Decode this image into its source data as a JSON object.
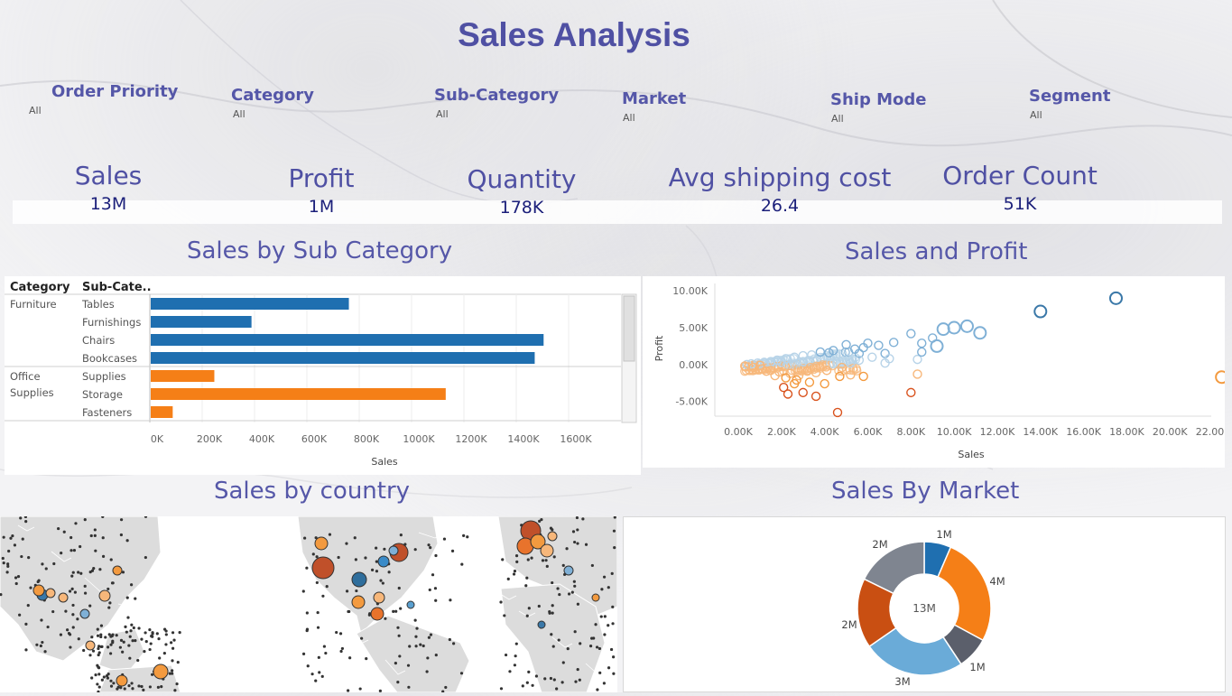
{
  "title": "Sales Analysis",
  "filters": [
    {
      "label": "Order Priority",
      "value": "All"
    },
    {
      "label": "Category",
      "value": "All"
    },
    {
      "label": "Sub-Category",
      "value": "All"
    },
    {
      "label": "Market",
      "value": "All"
    },
    {
      "label": "Ship Mode",
      "value": "All"
    },
    {
      "label": "Segment",
      "value": "All"
    }
  ],
  "kpis": [
    {
      "label": "Sales",
      "value": "13M"
    },
    {
      "label": "Profit",
      "value": "1M"
    },
    {
      "label": "Quantity",
      "value": "178K"
    },
    {
      "label": "Avg shipping cost",
      "value": "26.4"
    },
    {
      "label": "Order Count",
      "value": "51K"
    }
  ],
  "sections": {
    "subcategory": "Sales by Sub Category",
    "scatter": "Sales and Profit",
    "country": "Sales by country",
    "market": "Sales By Market"
  },
  "colors": {
    "furniture": "#1f6fb0",
    "office": "#f57f17",
    "accent": "#4f50a3"
  },
  "chart_data": [
    {
      "type": "bar",
      "orientation": "horizontal",
      "headers": [
        "Category",
        "Sub-Cate.."
      ],
      "xlabel": "Sales",
      "xlim": [
        0,
        1800000
      ],
      "ticks": [
        "0K",
        "200K",
        "400K",
        "600K",
        "800K",
        "1000K",
        "1200K",
        "1400K",
        "1600K"
      ],
      "groups": [
        {
          "category": "Furniture",
          "color": "#1f6fb0",
          "items": [
            {
              "name": "Tables",
              "value": 757000
            },
            {
              "name": "Furnishings",
              "value": 385000
            },
            {
              "name": "Chairs",
              "value": 1501000
            },
            {
              "name": "Bookcases",
              "value": 1467000
            }
          ]
        },
        {
          "category": "Office Supplies",
          "color": "#f57f17",
          "items": [
            {
              "name": "Supplies",
              "value": 243000
            },
            {
              "name": "Storage",
              "value": 1127000
            },
            {
              "name": "Fasteners",
              "value": 84000
            }
          ]
        }
      ]
    },
    {
      "type": "scatter",
      "xlabel": "Sales",
      "ylabel": "Profit",
      "xlim": [
        0,
        23000
      ],
      "ylim": [
        -7000,
        11000
      ],
      "xticks": [
        "0.00K",
        "2.00K",
        "4.00K",
        "6.00K",
        "8.00K",
        "10.00K",
        "12.00K",
        "14.00K",
        "16.00K",
        "18.00K",
        "20.00K",
        "22.00K"
      ],
      "yticks": [
        "10.00K",
        "5.00K",
        "0.00K",
        "-5.00K"
      ],
      "points": [
        [
          17500,
          9000
        ],
        [
          14000,
          7200
        ],
        [
          22400,
          -1700
        ],
        [
          11200,
          4300
        ],
        [
          10600,
          5200
        ],
        [
          10000,
          5000
        ],
        [
          9500,
          4800
        ],
        [
          9000,
          3600
        ],
        [
          8500,
          2900
        ],
        [
          9200,
          2500
        ],
        [
          8000,
          4200
        ],
        [
          7200,
          3000
        ],
        [
          6500,
          2600
        ],
        [
          6000,
          2900
        ],
        [
          5800,
          2300
        ],
        [
          5400,
          2100
        ],
        [
          5000,
          2700
        ],
        [
          8300,
          -1300
        ],
        [
          8000,
          -3800
        ],
        [
          8300,
          700
        ],
        [
          8500,
          1700
        ],
        [
          5800,
          -1600
        ],
        [
          5200,
          -1400
        ],
        [
          4700,
          -1600
        ],
        [
          4000,
          -2600
        ],
        [
          3600,
          -4300
        ],
        [
          3000,
          -3800
        ],
        [
          2600,
          -2600
        ],
        [
          2300,
          -4000
        ],
        [
          2100,
          -3100
        ],
        [
          4600,
          -6500
        ],
        [
          6800,
          1500
        ],
        [
          6800,
          200
        ],
        [
          7000,
          800
        ],
        [
          6200,
          1000
        ],
        [
          5600,
          1500
        ],
        [
          4400,
          1900
        ],
        [
          4200,
          1600
        ],
        [
          3800,
          1700
        ],
        [
          3400,
          1300
        ],
        [
          3000,
          1200
        ],
        [
          2600,
          1000
        ],
        [
          2200,
          800
        ],
        [
          1800,
          600
        ],
        [
          1500,
          400
        ],
        [
          1200,
          300
        ],
        [
          900,
          200
        ],
        [
          600,
          100
        ],
        [
          400,
          0
        ],
        [
          300,
          -200
        ],
        [
          700,
          -400
        ],
        [
          1100,
          -600
        ],
        [
          1500,
          -800
        ],
        [
          1900,
          -1000
        ],
        [
          2400,
          -1200
        ],
        [
          2800,
          -1500
        ],
        [
          3200,
          -900
        ],
        [
          3600,
          -1100
        ],
        [
          4100,
          -800
        ],
        [
          4800,
          -400
        ],
        [
          5200,
          200
        ],
        [
          5600,
          600
        ],
        [
          3000,
          400
        ],
        [
          2000,
          300
        ],
        [
          1000,
          -100
        ],
        [
          1300,
          -900
        ],
        [
          1700,
          -1500
        ],
        [
          2200,
          -1800
        ],
        [
          2700,
          -2100
        ],
        [
          3300,
          -2400
        ]
      ]
    },
    {
      "type": "pie",
      "donut": true,
      "center_label": "13M",
      "slices": [
        {
          "label": "1M",
          "value": 0.75,
          "color": "#1f6fb0"
        },
        {
          "label": "4M",
          "value": 3.05,
          "color": "#f57f17"
        },
        {
          "label": "1M",
          "value": 0.9,
          "color": "#5b5f6b"
        },
        {
          "label": "3M",
          "value": 2.85,
          "color": "#6aabd8"
        },
        {
          "label": "2M",
          "value": 1.95,
          "color": "#c94f12"
        },
        {
          "label": "2M",
          "value": 2.05,
          "color": "#7f8590"
        }
      ]
    }
  ]
}
